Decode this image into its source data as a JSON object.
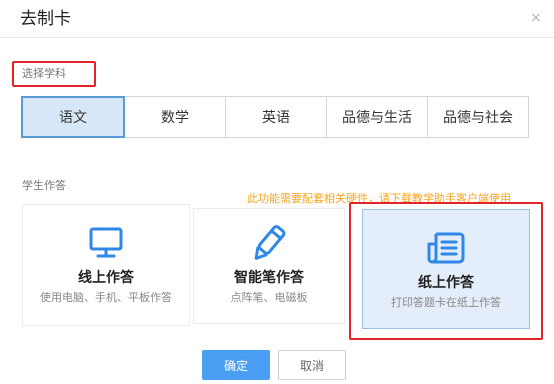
{
  "dialog": {
    "title": "去制卡",
    "close_symbol": "×"
  },
  "subject_section": {
    "label": "选择学科",
    "tabs": [
      {
        "label": "语文",
        "active": true
      },
      {
        "label": "数学",
        "active": false
      },
      {
        "label": "英语",
        "active": false
      },
      {
        "label": "品德与生活",
        "active": false
      },
      {
        "label": "品德与社会",
        "active": false
      }
    ]
  },
  "mode_section": {
    "label": "学生作答",
    "notice": "此功能需要配套相关硬件，请下载教学助手客户端使用",
    "cards": {
      "online": {
        "title": "线上作答",
        "desc": "使用电脑、手机、平板作答",
        "icon": "monitor-icon"
      },
      "pen": {
        "title": "智能笔作答",
        "desc": "点阵笔、电磁板",
        "icon": "pen-icon"
      },
      "paper": {
        "title": "纸上作答",
        "desc": "打印答题卡在纸上作答",
        "icon": "newspaper-icon",
        "selected": true
      }
    }
  },
  "footer": {
    "ok_label": "确定",
    "cancel_label": "取消"
  },
  "colors": {
    "accent": "#4a9ff5",
    "active_tab_bg": "#d8e7f7",
    "highlight_red": "#e0252b",
    "notice_orange": "#f5a623"
  }
}
